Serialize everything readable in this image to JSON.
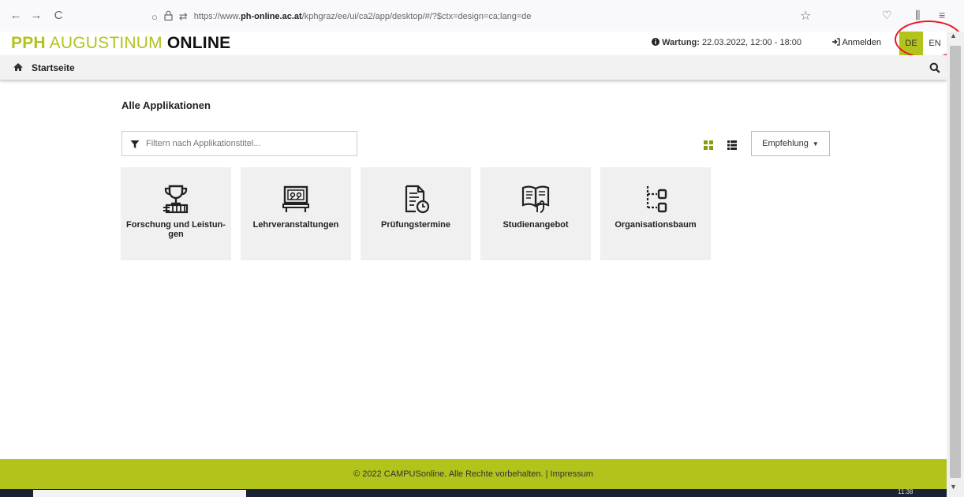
{
  "browser": {
    "back": "←",
    "forward": "→",
    "reload": "C",
    "url_prefix": "https://www.",
    "url_domain": "ph-online.ac.at",
    "url_path": "/kphgraz/ee/ui/ca2/app/desktop/#/?$ctx=design=ca;lang=de"
  },
  "header": {
    "brand_pph": "PPH",
    "brand_aug": " AUGUSTINUM ",
    "brand_online": "ONLINE",
    "maintenance_label": "Wartung:",
    "maintenance_time": " 22.03.2022, 12:00 - 18:00",
    "login": "Anmelden",
    "lang_de": "DE",
    "lang_en": "EN"
  },
  "nav": {
    "home": "Startseite"
  },
  "content": {
    "title": "Alle Applikationen",
    "filter_placeholder": "Filtern nach Applikationstitel...",
    "sort_label": "Empfehlung"
  },
  "tiles": [
    {
      "label": "Forschung und Leistun-gen",
      "icon": "trophy-icon"
    },
    {
      "label": "Lehrveranstaltungen",
      "icon": "lecture-board-icon"
    },
    {
      "label": "Prüfungstermine",
      "icon": "document-clock-icon"
    },
    {
      "label": "Studienangebot",
      "icon": "book-hand-icon"
    },
    {
      "label": "Organisationsbaum",
      "icon": "tree-structure-icon"
    }
  ],
  "footer": {
    "text": "© 2022 CAMPUSonline. Alle Rechte vorbehalten. | Impressum"
  },
  "taskbar": {
    "time": "11:38"
  },
  "colors": {
    "accent": "#b2c31c",
    "highlight_ring": "#e21b23"
  }
}
